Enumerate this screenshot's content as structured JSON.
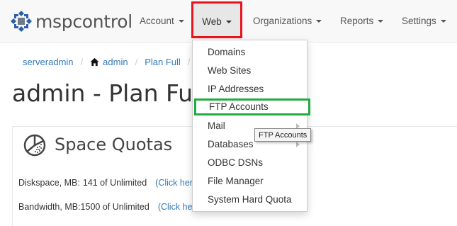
{
  "brand": {
    "name": "mspcontrol"
  },
  "nav": {
    "account": "Account",
    "web": "Web",
    "organizations": "Organizations",
    "reports": "Reports",
    "settings": "Settings"
  },
  "breadcrumb": {
    "item1": "serveradmin",
    "item2": "admin",
    "item3": "Plan Full"
  },
  "page": {
    "title": "admin - Plan Full"
  },
  "quotas": {
    "title": "Space Quotas",
    "rows": [
      {
        "label": "Diskspace, MB:",
        "value": "141 of Unlimited",
        "link": "(Click her"
      },
      {
        "label": "Bandwidth, MB:",
        "value": "1500 of Unlimited",
        "link": "(Click he"
      }
    ]
  },
  "web_menu": {
    "items": [
      {
        "label": "Domains"
      },
      {
        "label": "Web Sites"
      },
      {
        "label": "IP Addresses"
      },
      {
        "label": "FTP Accounts"
      },
      {
        "label": "Mail"
      },
      {
        "label": "Databases"
      },
      {
        "label": "ODBC DSNs"
      },
      {
        "label": "File Manager"
      },
      {
        "label": "System Hard Quota"
      }
    ]
  },
  "tooltip": {
    "text": "FTP Accounts"
  },
  "colors": {
    "highlight_red": "#e8141e",
    "highlight_green": "#22ab3f",
    "link": "#337ab7",
    "brand_blue": "#2b5ea7"
  }
}
